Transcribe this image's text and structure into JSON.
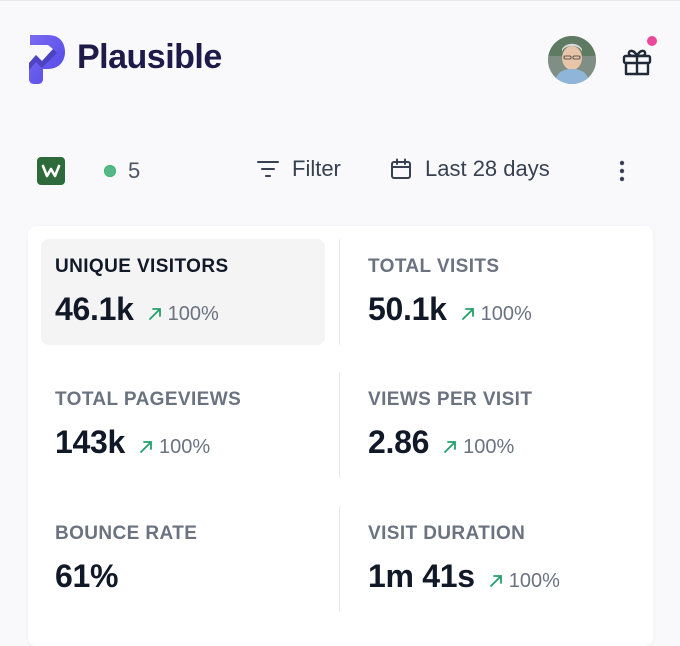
{
  "header": {
    "brand": "Plausible",
    "notification_color": "#ec4899"
  },
  "toolbar": {
    "site_favicon_letter": "w",
    "live_visitors": "5",
    "filter_label": "Filter",
    "period_label": "Last 28 days"
  },
  "metrics": [
    {
      "label": "UNIQUE VISITORS",
      "value": "46.1k",
      "change": "100%",
      "active": true
    },
    {
      "label": "TOTAL VISITS",
      "value": "50.1k",
      "change": "100%"
    },
    {
      "label": "TOTAL PAGEVIEWS",
      "value": "143k",
      "change": "100%"
    },
    {
      "label": "VIEWS PER VISIT",
      "value": "2.86",
      "change": "100%"
    },
    {
      "label": "BOUNCE RATE",
      "value": "61%",
      "change": ""
    },
    {
      "label": "VISIT DURATION",
      "value": "1m 41s",
      "change": "100%"
    }
  ],
  "colors": {
    "brand_primary": "#5850ec",
    "brand_text": "#1e1b4b",
    "positive_change": "#22a06b",
    "live_dot": "#56b88a"
  }
}
